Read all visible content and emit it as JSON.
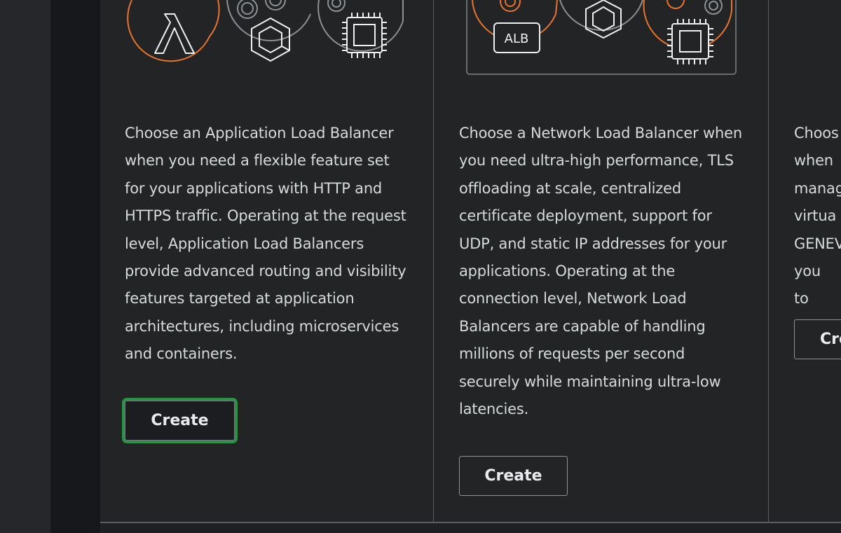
{
  "cards": [
    {
      "id": "alb",
      "description": "Choose an Application Load Balancer when you need a flexible feature set for your applications with HTTP and HTTPS traffic. Operating at the request level, Application Load Balancers provide advanced routing and visibility features targeted at application architectures, including microservices and containers.",
      "button_label": "Create",
      "icons": [
        "lambda-icon",
        "target-icon",
        "container-icon",
        "chip-icon"
      ]
    },
    {
      "id": "nlb",
      "description": "Choose a Network Load Balancer when you need ultra-high performance, TLS offloading at scale, centralized certificate deployment, support for UDP, and static IP addresses for your applications. Operating at the connection level, Network Load Balancers are capable of handling millions of requests per second securely while maintaining ultra-low latencies.",
      "button_label": "Create",
      "badge": "ALB",
      "icons": [
        "target-icon",
        "alb-badge-icon",
        "container-icon",
        "chip-icon"
      ]
    },
    {
      "id": "gwlb",
      "description": "Choos when manag virtua GENEV you to compl",
      "button_label": "Create"
    }
  ],
  "colors": {
    "orange": "#e8742c",
    "gray_line": "#8b9196",
    "white_line": "#eef0f1",
    "focus_ring": "#2a9145"
  }
}
